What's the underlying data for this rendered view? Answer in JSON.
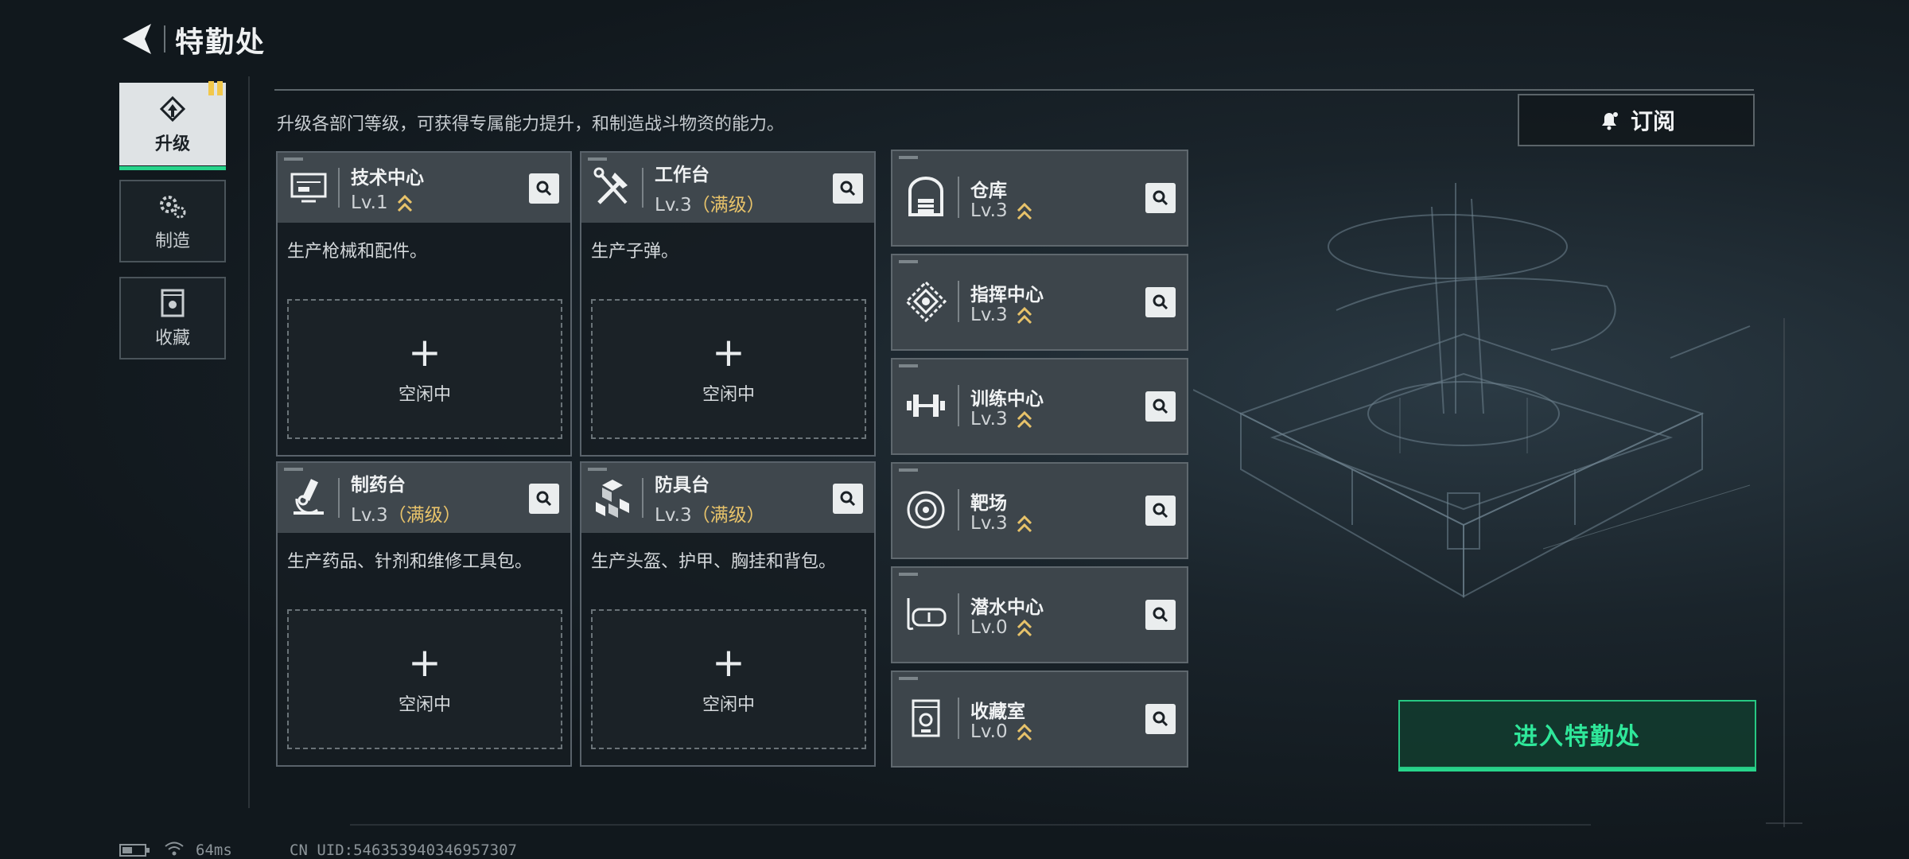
{
  "header": {
    "title": "特勤处"
  },
  "nav": [
    {
      "label": "升级",
      "icon": "upgrade-icon",
      "active": true
    },
    {
      "label": "制造",
      "icon": "gears-icon",
      "active": false
    },
    {
      "label": "收藏",
      "icon": "collection-icon",
      "active": false
    }
  ],
  "description": "升级各部门等级，可获得专属能力提升，和制造战斗物资的能力。",
  "subscribe": {
    "label": "订阅",
    "icon": "bell-icon"
  },
  "stations": [
    {
      "name": "技术中心",
      "level": "Lv.1",
      "max": "",
      "desc": "生产枪械和配件。",
      "slot": "空闲中",
      "icon": "monitor-icon"
    },
    {
      "name": "工作台",
      "level": "Lv.3",
      "max": "（满级）",
      "desc": "生产子弹。",
      "slot": "空闲中",
      "icon": "tools-icon"
    },
    {
      "name": "制药台",
      "level": "Lv.3",
      "max": "（满级）",
      "desc": "生产药品、针剂和维修工具包。",
      "slot": "空闲中",
      "icon": "microscope-icon"
    },
    {
      "name": "防具台",
      "level": "Lv.3",
      "max": "（满级）",
      "desc": "生产头盔、护甲、胸挂和背包。",
      "slot": "空闲中",
      "icon": "armor-blocks-icon"
    }
  ],
  "facilities": [
    {
      "name": "仓库",
      "level": "Lv.3",
      "icon": "warehouse-icon"
    },
    {
      "name": "指挥中心",
      "level": "Lv.3",
      "icon": "command-icon"
    },
    {
      "name": "训练中心",
      "level": "Lv.3",
      "icon": "dumbbell-icon"
    },
    {
      "name": "靶场",
      "level": "Lv.3",
      "icon": "target-icon"
    },
    {
      "name": "潜水中心",
      "level": "Lv.0",
      "icon": "diving-mask-icon"
    },
    {
      "name": "收藏室",
      "level": "Lv.0",
      "icon": "collection-room-icon"
    }
  ],
  "enter_button": {
    "label": "进入特勤处"
  },
  "status": {
    "ping": "64ms",
    "uid": "CN UID:546353940346957307"
  },
  "colors": {
    "accent": "#27d48b",
    "max_level": "#e8c36a",
    "badge": "#f2c84b"
  }
}
